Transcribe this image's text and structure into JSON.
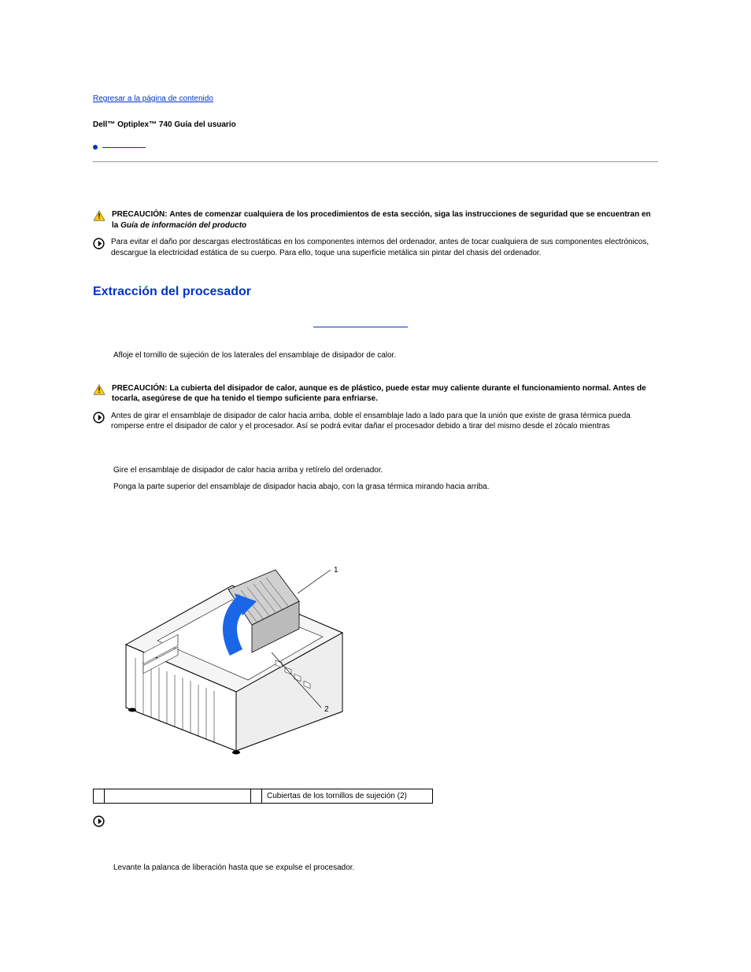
{
  "topLink": "Regresar a la página de contenido",
  "docTitle": "Dell™ Optiplex™ 740 Guía del usuario",
  "caution1": {
    "label": "PRECAUCIÓN:",
    "text": "Antes de comenzar cualquiera de los procedimientos de esta sección, siga las instrucciones de seguridad que se encuentran en la ",
    "italic": "Guía de información del producto"
  },
  "avoid1": "Para evitar el daño por descargas electrostáticas en los componentes internos del ordenador, antes de tocar cualquiera de sus componentes electrónicos, descargue la electricidad estática de su cuerpo. Para ello, toque una superficie metálica sin pintar del chasis del ordenador.",
  "sectionHeading": "Extracción del procesador",
  "step1": "Afloje el tornillo de sujeción de los laterales del ensamblaje de disipador de calor.",
  "caution2": {
    "label": "PRECAUCIÓN:",
    "text": "La cubierta del disipador de calor, aunque es de plástico, puede estar muy caliente durante el funcionamiento normal. Antes de tocarla, asegúrese de que ha tenido el tiempo suficiente para enfriarse."
  },
  "avoid2": "Antes de girar el ensamblaje de disipador de calor hacia arriba, doble el ensamblaje lado a lado para que la unión que existe de grasa térmica pueda romperse entre el disipador de calor y el procesador. Así se podrá evitar dañar el procesador debido a tirar del mismo desde el zócalo mientras",
  "step2": "Gire el ensamblaje de disipador de calor hacia arriba y retírelo del ordenador.",
  "step3": "Ponga la parte superior del ensamblaje de disipador hacia abajo, con la grasa térmica mirando hacia arriba.",
  "partsRow": {
    "n1": "",
    "l1": "",
    "n2": "",
    "l2": "Cubiertas de los tornillos de sujeción (2)"
  },
  "step4": "Levante la palanca de liberación hasta que se expulse el procesador."
}
